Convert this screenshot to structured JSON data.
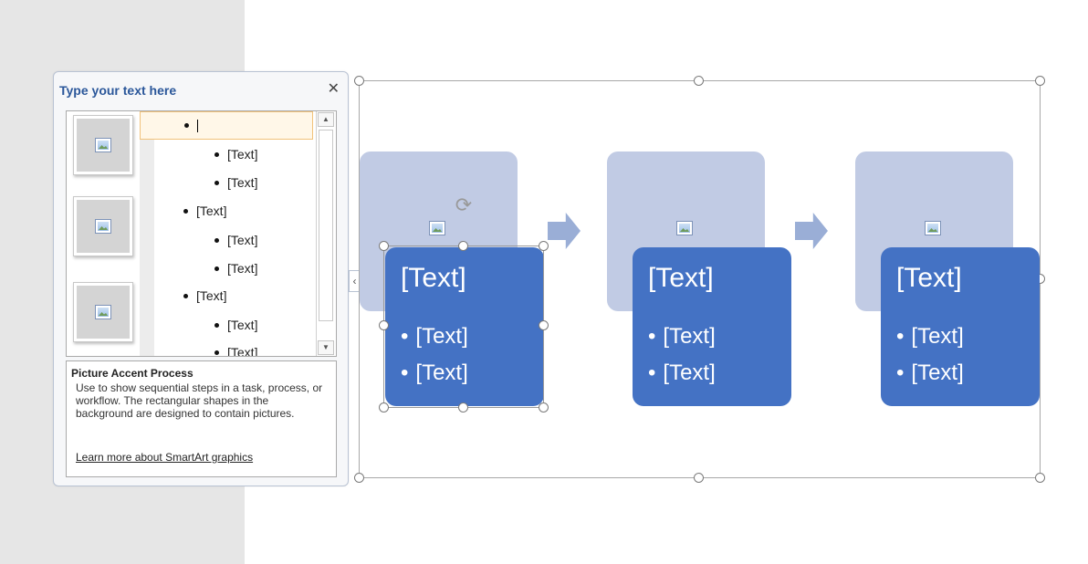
{
  "text_pane": {
    "title": "Type your text here",
    "close_icon": "close-icon",
    "items": [
      {
        "level": 1,
        "text": "",
        "active": true
      },
      {
        "level": 2,
        "text": "[Text]"
      },
      {
        "level": 2,
        "text": "[Text]"
      },
      {
        "level": 1,
        "text": "[Text]"
      },
      {
        "level": 2,
        "text": "[Text]"
      },
      {
        "level": 2,
        "text": "[Text]"
      },
      {
        "level": 1,
        "text": "[Text]"
      },
      {
        "level": 2,
        "text": "[Text]"
      },
      {
        "level": 2,
        "text": "[Text]"
      }
    ],
    "description_title": "Picture Accent Process",
    "description_text": "Use to show sequential steps in a task, process, or workflow. The rectangular shapes in the background are designed to contain pictures.",
    "learn_more_link": "Learn more about SmartArt graphics"
  },
  "smartart": {
    "steps": [
      {
        "title": "[Text]",
        "bullets": [
          "[Text]",
          "[Text]"
        ]
      },
      {
        "title": "[Text]",
        "bullets": [
          "[Text]",
          "[Text]"
        ]
      },
      {
        "title": "[Text]",
        "bullets": [
          "[Text]",
          "[Text]"
        ]
      }
    ]
  },
  "colors": {
    "accent_blue": "#4472c4",
    "light_blue": "#c1cbe4",
    "arrow_blue": "#9aaed6",
    "pane_title": "#2b579a"
  }
}
